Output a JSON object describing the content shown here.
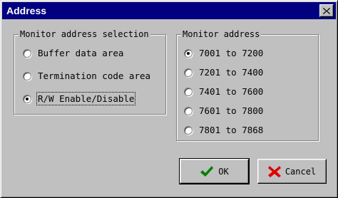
{
  "window": {
    "title": "Address"
  },
  "selection_group": {
    "legend": "Monitor address selection",
    "options": [
      {
        "label": "Buffer data area",
        "checked": false
      },
      {
        "label": "Termination code area",
        "checked": false
      },
      {
        "label": "R/W Enable/Disable",
        "checked": true
      }
    ]
  },
  "address_group": {
    "legend": "Monitor address",
    "options": [
      {
        "label": "7001 to 7200",
        "checked": true
      },
      {
        "label": "7201 to 7400",
        "checked": false
      },
      {
        "label": "7401 to 7600",
        "checked": false
      },
      {
        "label": "7601 to 7800",
        "checked": false
      },
      {
        "label": "7801 to 7868",
        "checked": false
      }
    ]
  },
  "buttons": {
    "ok": "OK",
    "cancel": "Cancel"
  },
  "icons": {
    "ok": "checkmark-icon",
    "cancel": "x-icon",
    "close": "close-icon"
  },
  "colors": {
    "titlebar": "#000080",
    "ok_check": "#008000",
    "cancel_x": "#e00000"
  }
}
